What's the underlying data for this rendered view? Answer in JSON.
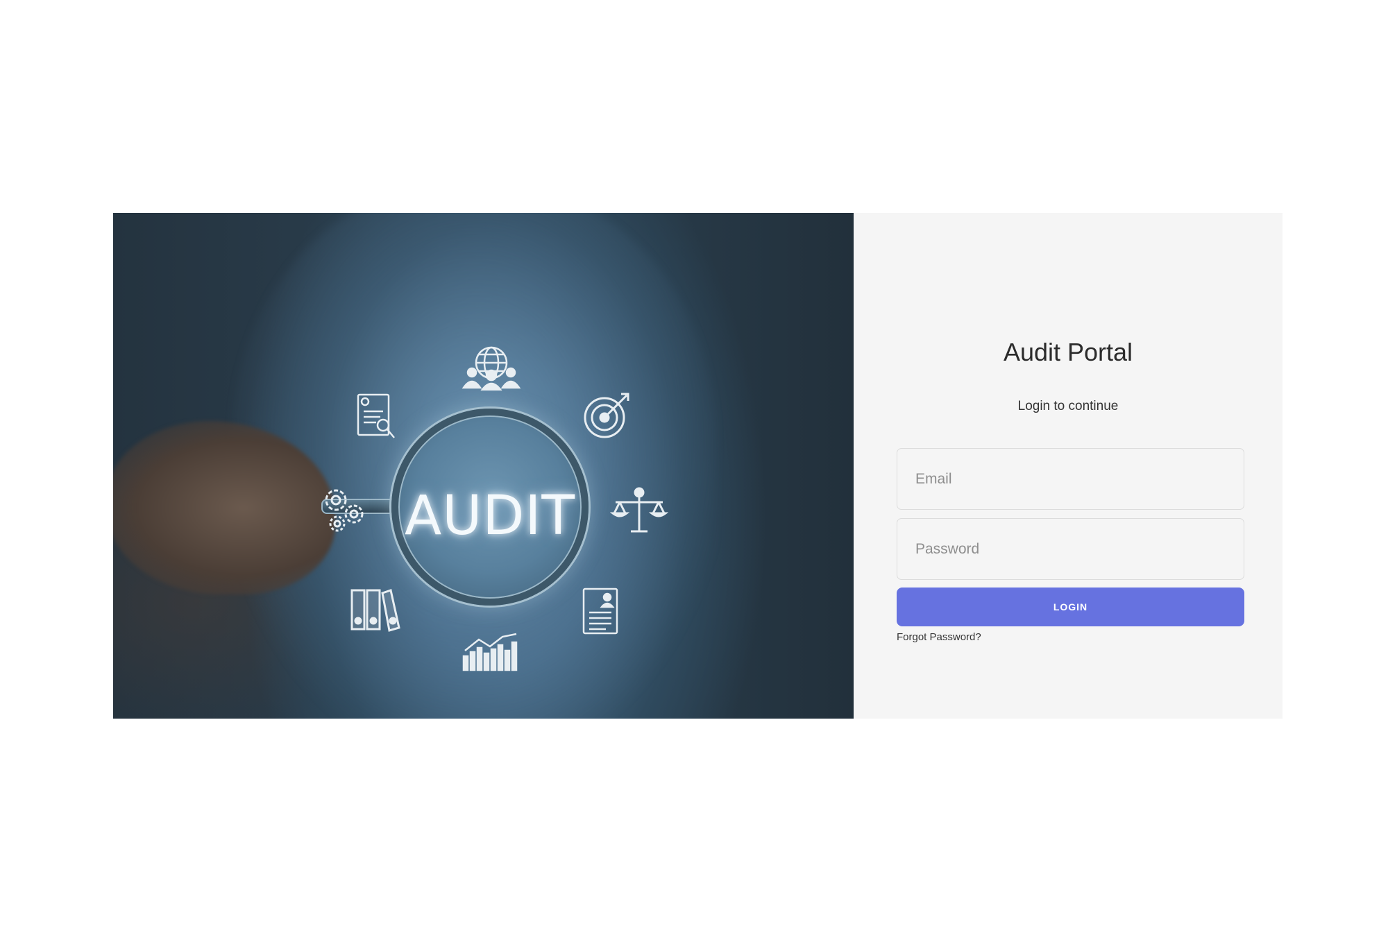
{
  "hero": {
    "headline": "AUDIT",
    "icons": [
      "globe-people-icon",
      "certificate-document-icon",
      "target-icon",
      "gears-icon",
      "scales-icon",
      "binders-icon",
      "profile-document-icon",
      "growth-chart-icon"
    ]
  },
  "login": {
    "title": "Audit Portal",
    "subtitle": "Login to continue",
    "email_placeholder": "Email",
    "password_placeholder": "Password",
    "login_label": "LOGIN",
    "forgot_label": "Forgot Password?"
  },
  "colors": {
    "accent": "#6672e0",
    "panel_background": "#f5f5f5",
    "page_background": "#ffffff"
  }
}
